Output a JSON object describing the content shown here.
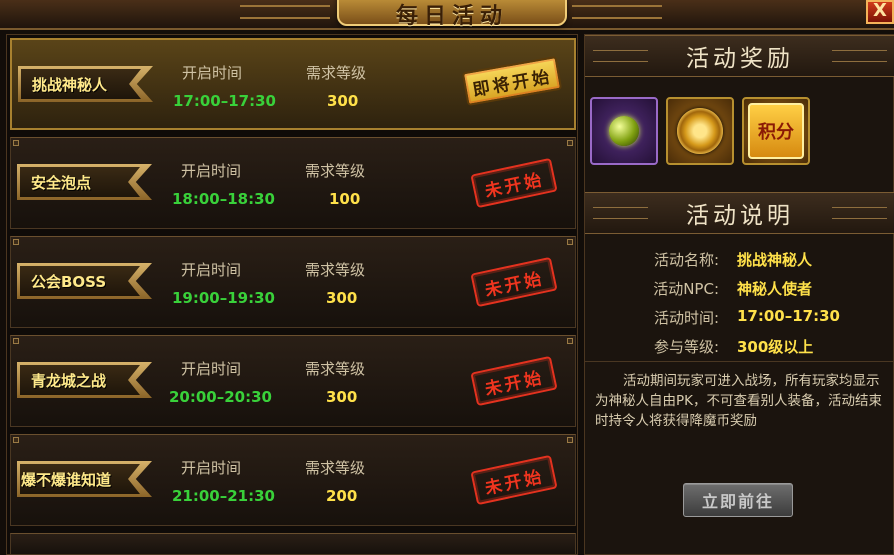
{
  "window": {
    "title": "每日活动",
    "close_label": "X"
  },
  "list": {
    "time_header": "开启时间",
    "level_header": "需求等级",
    "rows": [
      {
        "name": "挑战神秘人",
        "time": "17:00–17:30",
        "level": "300",
        "status": "即将开始"
      },
      {
        "name": "安全泡点",
        "time": "18:00–18:30",
        "level": "100",
        "status": "未开始"
      },
      {
        "name": "公会BOSS",
        "time": "19:00–19:30",
        "level": "300",
        "status": "未开始"
      },
      {
        "name": "青龙城之战",
        "time": "20:00–20:30",
        "level": "300",
        "status": "未开始"
      },
      {
        "name": "爆不爆谁知道",
        "time": "21:00–21:30",
        "level": "200",
        "status": "未开始"
      }
    ]
  },
  "rewards": {
    "title": "活动奖励",
    "items": [
      {
        "icon": "green-gem-icon"
      },
      {
        "icon": "gold-coin-icon"
      },
      {
        "icon": "points-icon",
        "label": "积分"
      }
    ]
  },
  "details": {
    "title": "活动说明",
    "name_label": "活动名称:",
    "name_value": "挑战神秘人",
    "npc_label": "活动NPC:",
    "npc_value": "神秘人使者",
    "time_label": "活动时间:",
    "time_value": "17:00–17:30",
    "level_label": "参与等级:",
    "level_value": "300级以上",
    "description": "活动期间玩家可进入战场，所有玩家均显示为神秘人自由PK，不可查看别人装备，活动结束时持令人将获得降魔币奖励",
    "go_button": "立即前往"
  },
  "colors": {
    "time_green": "#39d13a",
    "level_yellow": "#ffe14a",
    "stamp_red": "#e4321f",
    "gold": "#b7902f"
  }
}
